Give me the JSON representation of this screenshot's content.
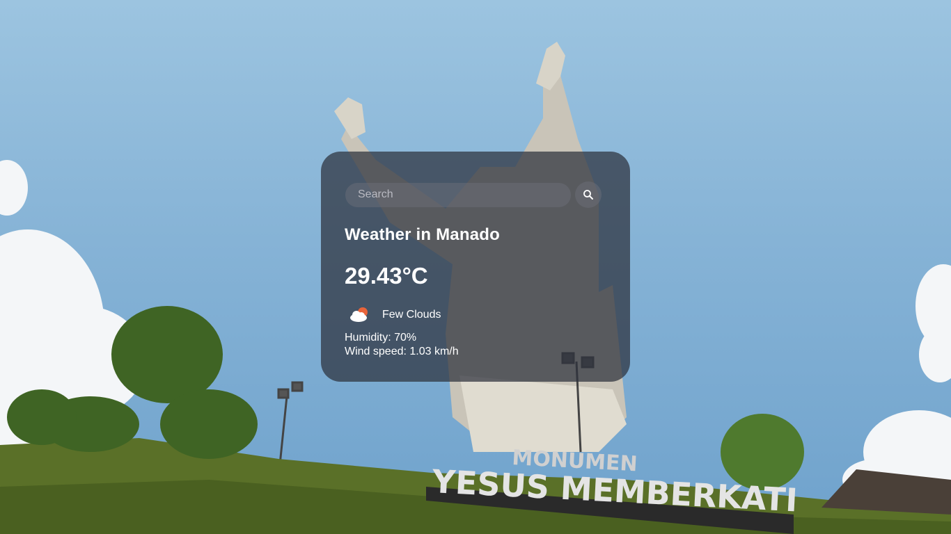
{
  "search": {
    "placeholder": "Search",
    "icon": "search-icon"
  },
  "weather": {
    "title": "Weather in Manado",
    "temperature": "29.43°C",
    "description": "Few Clouds",
    "icon": "few-clouds-icon",
    "humidity": "Humidity: 70%",
    "wind": "Wind speed: 1.03 km/h"
  },
  "background": {
    "sign_text": "YESUS MEMBERKATI",
    "sign_upper_text": "MONUMEN"
  },
  "colors": {
    "card_bg": "#2d303c",
    "icon_sun": "#e8643a",
    "icon_cloud": "#ffffff"
  }
}
